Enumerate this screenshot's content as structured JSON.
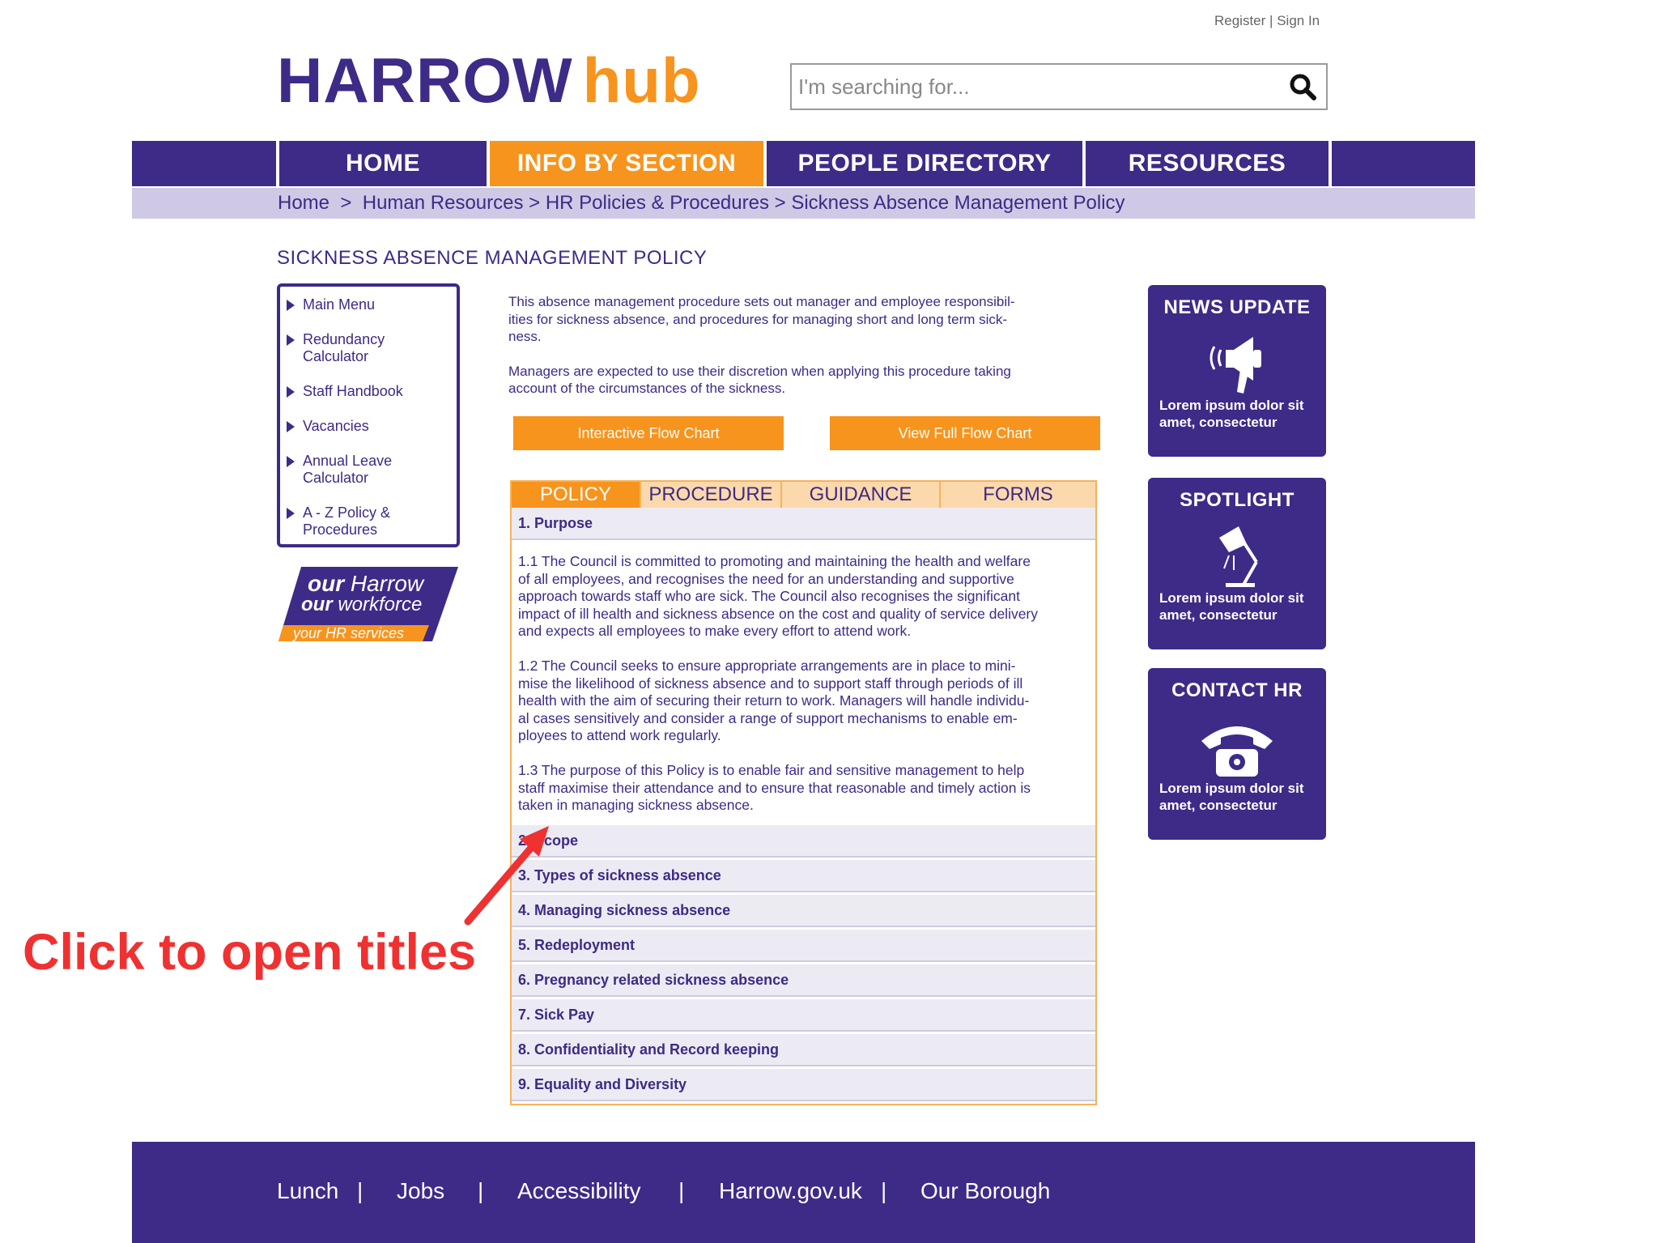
{
  "header": {
    "register_label": "Register",
    "divider": "|",
    "signin_label": "Sign In",
    "logo_main": "HARROW",
    "logo_hub": "hub",
    "search_placeholder": "I'm searching for..."
  },
  "nav": {
    "items": [
      {
        "label": "HOME"
      },
      {
        "label": "INFO BY SECTION"
      },
      {
        "label": "PEOPLE DIRECTORY"
      },
      {
        "label": "RESOURCES"
      }
    ],
    "active_index": 1
  },
  "breadcrumb": {
    "items": [
      "Home",
      "Human Resources",
      "HR Policies & Procedures",
      "Sickness Absence Management Policy"
    ],
    "separator": ">"
  },
  "page_title": "SICKNESS ABSENCE MANAGEMENT POLICY",
  "sidebar": {
    "items": [
      {
        "line1": "Main Menu",
        "line2": ""
      },
      {
        "line1": "Redundancy",
        "line2": "Calculator"
      },
      {
        "line1": "Staff Handbook",
        "line2": ""
      },
      {
        "line1": "Vacancies",
        "line2": ""
      },
      {
        "line1": "Annual Leave",
        "line2": "Calculator"
      },
      {
        "line1": "A - Z Policy &",
        "line2": "Procedures"
      }
    ],
    "badge": {
      "line1_a": "our",
      "line1_b": "Harrow",
      "line2_a": "our",
      "line2_b": "workforce",
      "line3": "your HR services"
    }
  },
  "intro": {
    "p1_l1": "This absence management procedure sets out manager and employee responsibil-",
    "p1_l2": "ities for sickness absence, and procedures for managing short and long term sick-",
    "p1_l3": "ness.",
    "p2_l1": "Managers are expected to use their discretion when applying this procedure taking",
    "p2_l2": "account of the circumstances of the sickness."
  },
  "buttons": {
    "interactive": "Interactive Flow Chart",
    "full": "View Full Flow Chart"
  },
  "tabs": [
    {
      "label": "POLICY"
    },
    {
      "label": "PROCEDURE"
    },
    {
      "label": "GUIDANCE"
    },
    {
      "label": "FORMS"
    }
  ],
  "sections": [
    {
      "title": "1.  Purpose"
    },
    {
      "title": "2.  Scope"
    },
    {
      "title": "3. Types of sickness absence"
    },
    {
      "title": "4. Managing sickness absence"
    },
    {
      "title": "5. Redeployment"
    },
    {
      "title": "6. Pregnancy related sickness absence"
    },
    {
      "title": "7. Sick Pay"
    },
    {
      "title": "8. Confidentiality and Record keeping"
    },
    {
      "title": "9. Equality and Diversity"
    }
  ],
  "purpose_body": {
    "p1": [
      "1.1 The Council is committed to promoting and maintaining the health and welfare",
      "of all employees, and recognises the need for an understanding and supportive",
      "approach towards staff who are sick.  The Council also recognises the significant",
      "impact of ill health and sickness absence on the cost and quality of service delivery",
      "and expects all employees to make every effort to attend work."
    ],
    "p2": [
      "1.2 The Council seeks to ensure appropriate arrangements are in place to mini-",
      "mise the likelihood of sickness absence and to support staff through periods of ill",
      "health with the aim of securing their return to work.  Managers will handle individu-",
      "al cases sensitively and consider a range of support mechanisms to enable em-",
      "ployees to attend work regularly."
    ],
    "p3": [
      "1.3 The purpose of this Policy is to enable fair and sensitive management to help",
      "staff maximise their attendance and to ensure that reasonable and timely action is",
      "taken in managing sickness absence."
    ]
  },
  "cards": [
    {
      "title": "NEWS UPDATE",
      "icon": "megaphone-icon",
      "text_l1": "Lorem ipsum dolor sit",
      "text_l2": "amet, consectetur"
    },
    {
      "title": "SPOTLIGHT",
      "icon": "desk-lamp-icon",
      "text_l1": "Lorem ipsum dolor sit",
      "text_l2": "amet, consectetur"
    },
    {
      "title": "CONTACT HR",
      "icon": "telephone-icon",
      "text_l1": "Lorem ipsum dolor sit",
      "text_l2": "amet, consectetur"
    }
  ],
  "annotation": "Click to open titles",
  "footer": {
    "links": [
      "Lunch",
      "Jobs",
      "Accessibility",
      "Harrow.gov.uk",
      "Our Borough"
    ],
    "separator": "|"
  },
  "colors": {
    "brand_purple": "#3e2a87",
    "brand_orange": "#f7941d",
    "breadcrumb_bg": "#cfc9e6",
    "annotation_red": "#ef3131"
  }
}
